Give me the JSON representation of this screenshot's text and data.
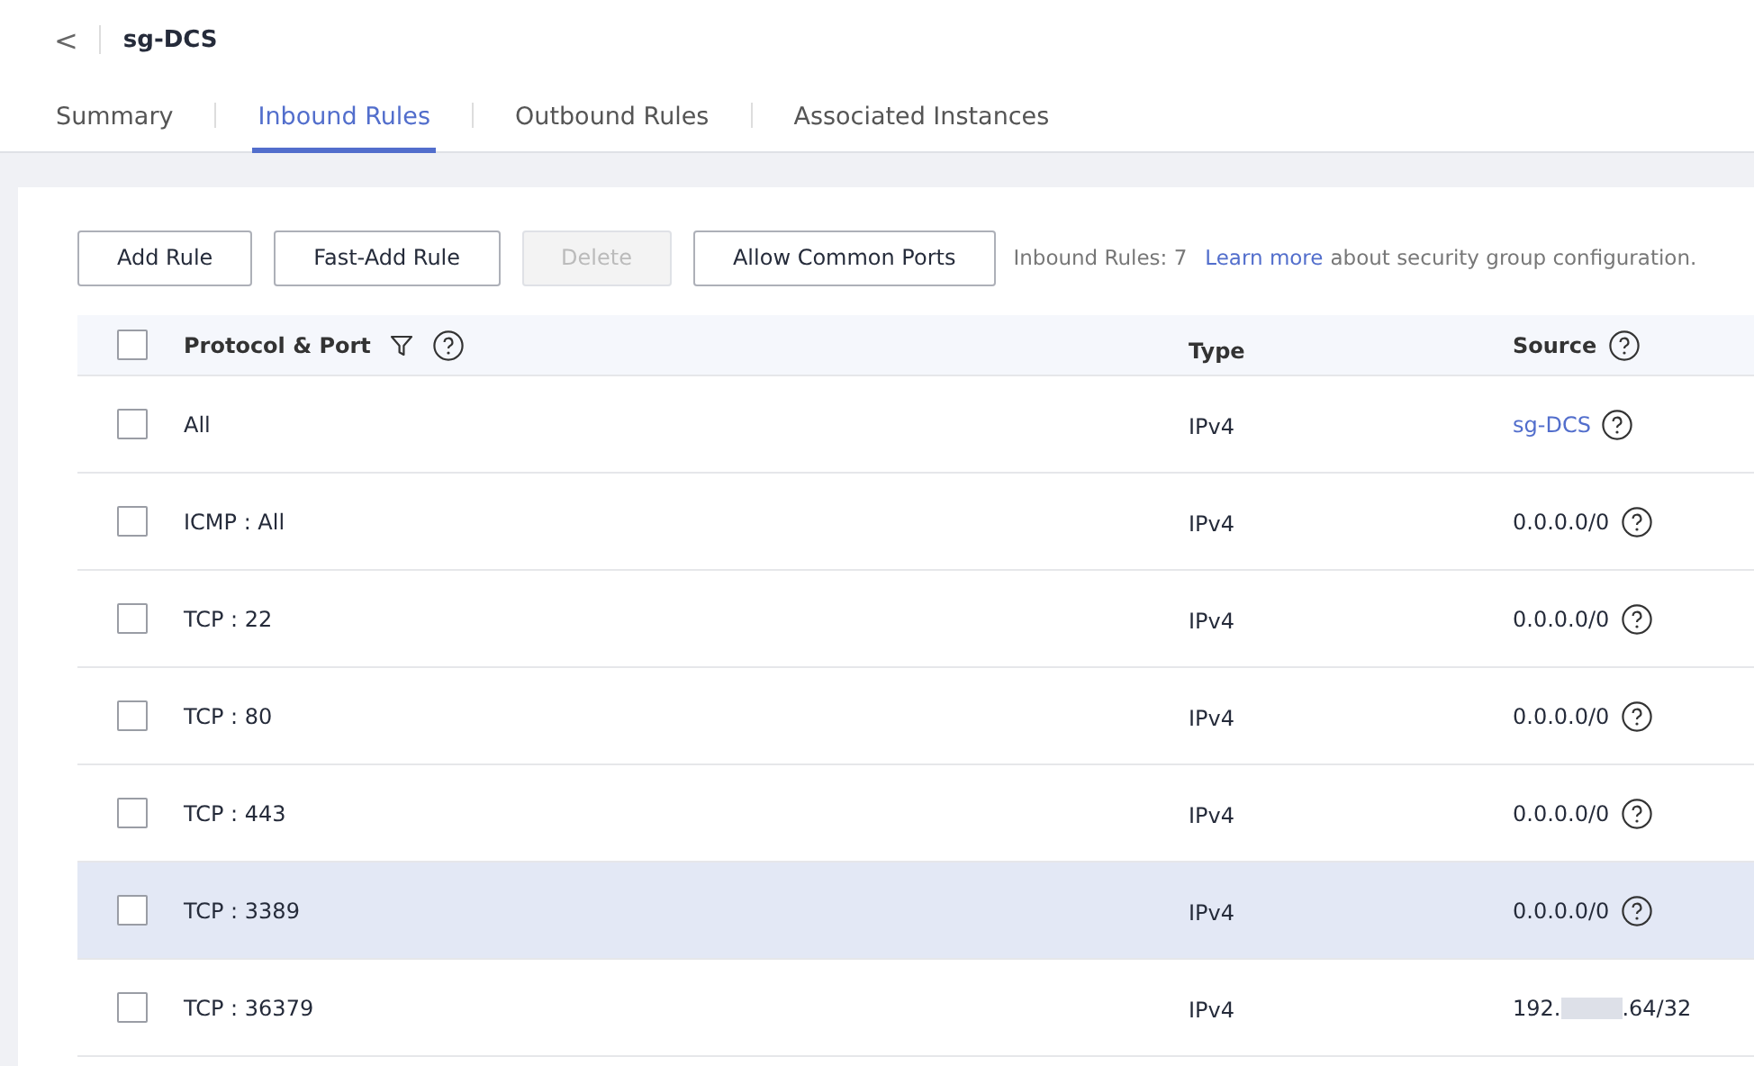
{
  "header": {
    "back": "<",
    "title": "sg-DCS"
  },
  "tabs": [
    {
      "label": "Summary",
      "selected": false
    },
    {
      "label": "Inbound Rules",
      "selected": true
    },
    {
      "label": "Outbound Rules",
      "selected": false
    },
    {
      "label": "Associated Instances",
      "selected": false
    }
  ],
  "toolbar": {
    "buttons": [
      {
        "label": "Add Rule",
        "disabled": false
      },
      {
        "label": "Fast-Add Rule",
        "disabled": false
      },
      {
        "label": "Delete",
        "disabled": true
      },
      {
        "label": "Allow Common Ports",
        "disabled": false
      }
    ],
    "count": "Inbound Rules: 7",
    "link": "Learn more",
    "note": "about security group configuration."
  },
  "table": {
    "select_all_checked": false,
    "columns": [
      "Protocol & Port",
      "Type",
      "Source"
    ],
    "rows": [
      {
        "protocol": "All",
        "type": "IPv4",
        "source": "sg-DCS",
        "kind": "link",
        "help": true,
        "checked": false,
        "highlighted": false
      },
      {
        "protocol": "ICMP : All",
        "type": "IPv4",
        "source": "0.0.0.0/0",
        "kind": "text",
        "help": true,
        "checked": false,
        "highlighted": false
      },
      {
        "protocol": "TCP : 22",
        "type": "IPv4",
        "source": "0.0.0.0/0",
        "kind": "text",
        "help": true,
        "checked": false,
        "highlighted": false
      },
      {
        "protocol": "TCP : 80",
        "type": "IPv4",
        "source": "0.0.0.0/0",
        "kind": "text",
        "help": true,
        "checked": false,
        "highlighted": false
      },
      {
        "protocol": "TCP : 443",
        "type": "IPv4",
        "source": "0.0.0.0/0",
        "kind": "text",
        "help": true,
        "checked": false,
        "highlighted": false
      },
      {
        "protocol": "TCP : 3389",
        "type": "IPv4",
        "source": "0.0.0.0/0",
        "kind": "text",
        "help": true,
        "checked": false,
        "highlighted": true
      },
      {
        "protocol": "TCP : 36379",
        "type": "IPv4",
        "source": "192.",
        "source_end": ".64/32",
        "kind": "redacted",
        "help": false,
        "checked": false,
        "highlighted": false
      }
    ]
  }
}
